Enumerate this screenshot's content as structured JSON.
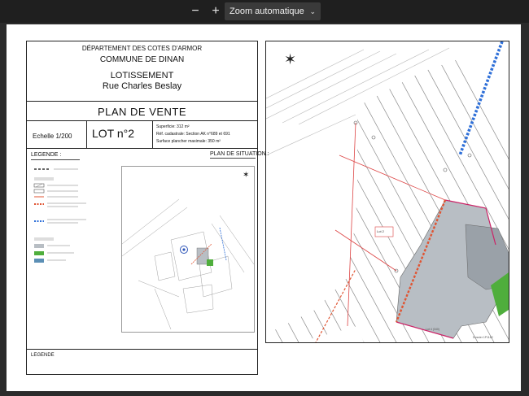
{
  "toolbar": {
    "zoom_out_label": "−",
    "zoom_in_label": "+",
    "zoom_value": "Zoom automatique",
    "chevron": "⌄"
  },
  "document": {
    "header": {
      "line1": "DÉPARTEMENT DES COTES D'ARMOR",
      "line2": "COMMUNE DE DINAN",
      "line3": "LOTISSEMENT",
      "line4": "Rue Charles Beslay"
    },
    "plan_title": "PLAN DE VENTE",
    "echelle": "Echelle 1/200",
    "lot": "LOT n°2",
    "info": {
      "superficie": "Superficie: 312 m²",
      "ref": "Réf. cadastrale: Section AK n°689 et 691",
      "surface": "Surface plancher maximale: 350 m²"
    },
    "legende_title": "LEGENDE :",
    "situation_title": "PLAN DE SITUATION :",
    "legende_footer": "LEGENDE",
    "plan_labels": {
      "lot_label": "Lot 2",
      "lot4": "Lot 4 (340)",
      "dossier": "Dossier 1P1182"
    }
  },
  "colors": {
    "toolbar_bg": "#1f1f1f",
    "viewer_bg": "#2b2b2b",
    "hatch": "#8a8a8a",
    "blue_line": "#2e6fd8",
    "red_dash": "#e05533",
    "magenta": "#cc2266",
    "building": "#b8bec4",
    "green": "#4fae3c"
  }
}
